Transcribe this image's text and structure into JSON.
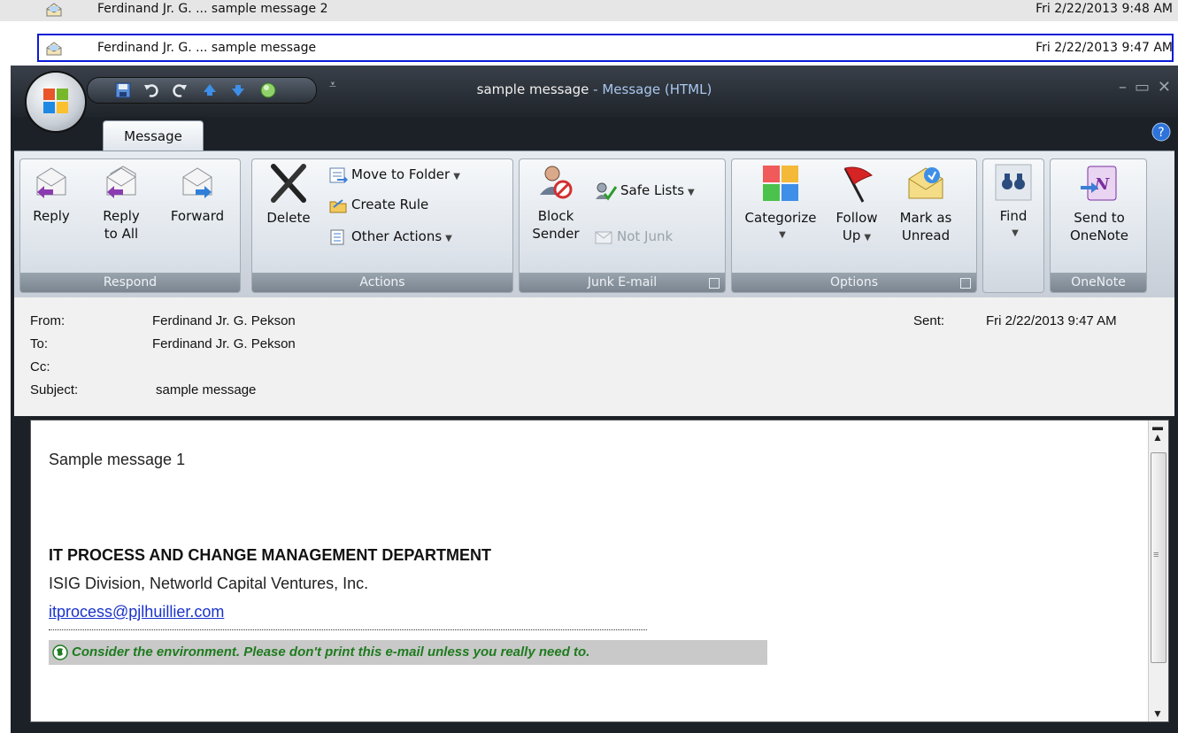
{
  "inbox": {
    "rows": [
      {
        "text": "Ferdinand Jr. G. ...  sample message 2",
        "date": "Fri 2/22/2013 9:48 AM"
      },
      {
        "text": "Ferdinand Jr. G. ...  sample message",
        "date": "Fri 2/22/2013 9:47 AM"
      }
    ]
  },
  "window": {
    "title_subject": "sample message",
    "title_sep": " - ",
    "title_app": "Message (HTML)"
  },
  "tabs": [
    {
      "label": "Message"
    }
  ],
  "ribbon": {
    "respond": {
      "label": "Respond",
      "reply": "Reply",
      "reply_all_1": "Reply",
      "reply_all_2": "to All",
      "forward": "Forward"
    },
    "actions": {
      "label": "Actions",
      "delete": "Delete",
      "move_to_folder": "Move to Folder",
      "create_rule": "Create Rule",
      "other_actions": "Other Actions"
    },
    "junk": {
      "label": "Junk E-mail",
      "block_1": "Block",
      "block_2": "Sender",
      "safe_lists": "Safe Lists",
      "not_junk": "Not Junk"
    },
    "options": {
      "label": "Options",
      "categorize": "Categorize",
      "follow_1": "Follow",
      "follow_2": "Up",
      "mark_1": "Mark as",
      "mark_2": "Unread"
    },
    "find": {
      "label": "Find"
    },
    "onenote": {
      "label": "OneNote",
      "send_1": "Send to",
      "send_2": "OneNote"
    }
  },
  "header": {
    "from_label": "From:",
    "from": "Ferdinand Jr. G. Pekson",
    "to_label": "To:",
    "to": "Ferdinand Jr. G. Pekson",
    "cc_label": "Cc:",
    "cc": "",
    "subject_label": "Subject:",
    "subject": "sample message",
    "sent_label": "Sent:",
    "sent": "Fri 2/22/2013 9:47 AM"
  },
  "body": {
    "line1": "Sample message 1",
    "dept": "IT PROCESS AND CHANGE MANAGEMENT DEPARTMENT",
    "division": "ISIG Division, Networld Capital Ventures, Inc.",
    "email": "itprocess@pjlhuillier.com",
    "env_note": "Consider the environment. Please don't print this e-mail unless you really need to."
  },
  "colors": {
    "selection_border": "#0a1ad8",
    "link": "#1a33cc",
    "env_text": "#1e7b1e"
  }
}
